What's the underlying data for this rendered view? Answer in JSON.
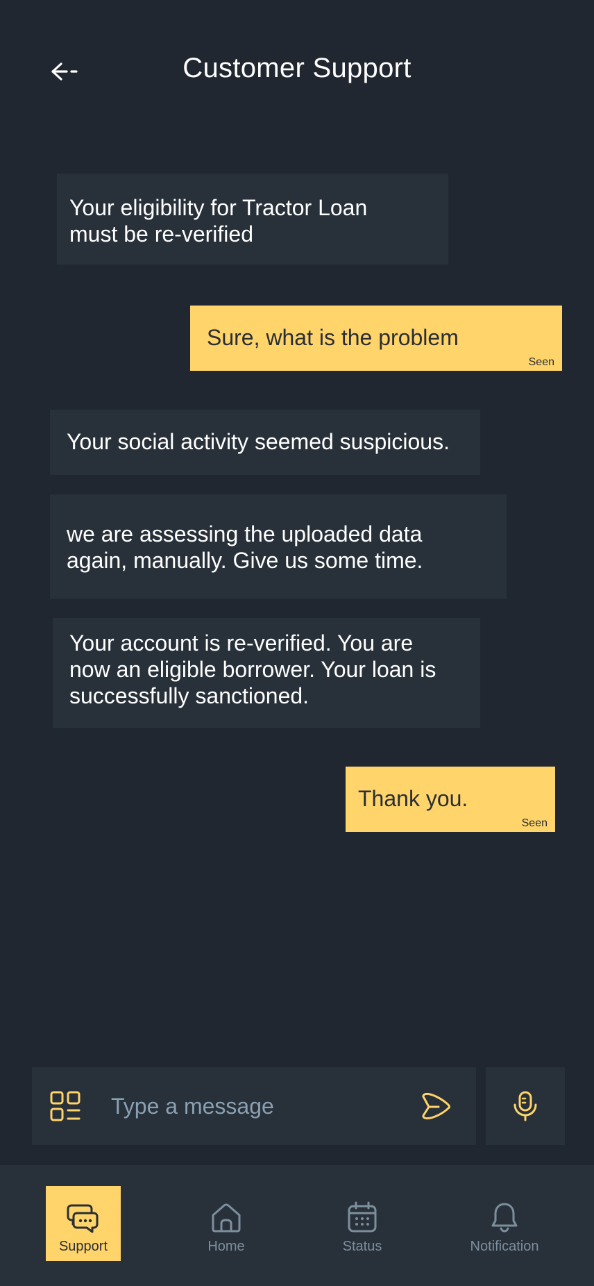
{
  "header": {
    "title": "Customer Support",
    "back_icon": "arrow-left-icon"
  },
  "messages": [
    {
      "direction": "incoming",
      "text_lines": [
        "Your eligibility for Tractor Loan",
        "must be re-verified"
      ]
    },
    {
      "direction": "outgoing",
      "text": "Sure, what is the problem",
      "status": "Seen"
    },
    {
      "direction": "incoming",
      "text": "Your social activity seemed suspicious."
    },
    {
      "direction": "incoming",
      "text_lines": [
        "we are assessing the uploaded data",
        "again, manually. Give us some time."
      ]
    },
    {
      "direction": "incoming",
      "text_lines": [
        "Your account is re-verified. You are",
        "now an eligible borrower. Your loan is",
        "successfully sanctioned."
      ]
    },
    {
      "direction": "outgoing",
      "text": "Thank you.",
      "status": "Seen"
    }
  ],
  "composer": {
    "placeholder": "Type a message",
    "value": "",
    "left_icon": "qr-code-icon",
    "send_icon": "send-icon",
    "mic_icon": "microphone-icon"
  },
  "nav": {
    "items": [
      {
        "label": "Support",
        "icon": "chat-bubbles-icon",
        "active": true
      },
      {
        "label": "Home",
        "icon": "home-icon",
        "active": false
      },
      {
        "label": "Status",
        "icon": "calendar-icon",
        "active": false
      },
      {
        "label": "Notification",
        "icon": "bell-icon",
        "active": false
      }
    ]
  },
  "colors": {
    "background": "#212730",
    "surface": "#28313a",
    "accent": "#ffd46b",
    "muted": "#7d8e9c"
  }
}
